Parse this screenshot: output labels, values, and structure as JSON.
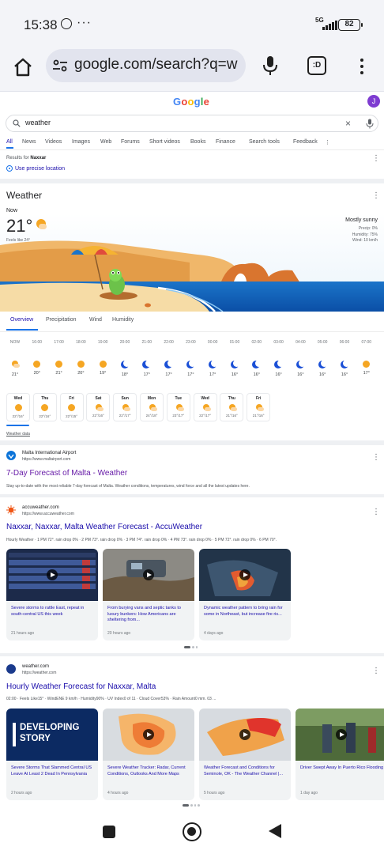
{
  "status": {
    "time": "15:38",
    "dots": "···",
    "network": "5G",
    "battery": "82"
  },
  "browser": {
    "url": "google.com/search?q=w",
    "tabs_label": ":D"
  },
  "google": {
    "logo": "Google",
    "avatar_initial": "J"
  },
  "search": {
    "query": "weather",
    "clear": "×"
  },
  "tabs": [
    "All",
    "News",
    "Videos",
    "Images",
    "Web",
    "Forums",
    "Short videos",
    "Books",
    "Finance",
    "Search tools",
    "Feedback"
  ],
  "location": {
    "prefix": "Results for",
    "place": "Naxxar",
    "precise": "Use precise location"
  },
  "weather": {
    "title": "Weather",
    "now": "Now",
    "temp": "21°",
    "feels": "Feels like 24°",
    "condition": "Mostly sunny",
    "precip": "Precip: 0%",
    "humidity": "Humidity: 75%",
    "wind": "Wind: 10 km/h",
    "tabs": [
      "Overview",
      "Precipitation",
      "Wind",
      "Humidity"
    ],
    "hourly": [
      {
        "time": "NOW",
        "icon": "partly-cloudy-icon",
        "temp": "21°"
      },
      {
        "time": "16:00",
        "icon": "sun-icon",
        "temp": "20°"
      },
      {
        "time": "17:00",
        "icon": "sun-icon",
        "temp": "21°"
      },
      {
        "time": "18:00",
        "icon": "sun-icon",
        "temp": "20°"
      },
      {
        "time": "19:00",
        "icon": "sun-icon",
        "temp": "19°"
      },
      {
        "time": "20:00",
        "icon": "moon-icon",
        "temp": "18°"
      },
      {
        "time": "21:00",
        "icon": "moon-icon",
        "temp": "17°"
      },
      {
        "time": "22:00",
        "icon": "moon-icon",
        "temp": "17°"
      },
      {
        "time": "23:00",
        "icon": "moon-icon",
        "temp": "17°"
      },
      {
        "time": "00:00",
        "icon": "moon-icon",
        "temp": "17°"
      },
      {
        "time": "01:00",
        "icon": "moon-icon",
        "temp": "16°"
      },
      {
        "time": "02:00",
        "icon": "moon-icon",
        "temp": "16°"
      },
      {
        "time": "03:00",
        "icon": "moon-icon",
        "temp": "16°"
      },
      {
        "time": "04:00",
        "icon": "moon-icon",
        "temp": "16°"
      },
      {
        "time": "05:00",
        "icon": "moon-icon",
        "temp": "16°"
      },
      {
        "time": "06:00",
        "icon": "moon-icon",
        "temp": "16°"
      },
      {
        "time": "07:00",
        "icon": "sun-icon",
        "temp": "17°"
      }
    ],
    "daily": [
      {
        "day": "Wed",
        "temps": "22°/16°",
        "icon": "sun-icon"
      },
      {
        "day": "Thu",
        "temps": "22°/16°",
        "icon": "sun-icon"
      },
      {
        "day": "Fri",
        "temps": "22°/15°",
        "icon": "sun-icon"
      },
      {
        "day": "Sat",
        "temps": "22°/16°",
        "icon": "partly-cloudy-icon"
      },
      {
        "day": "Sun",
        "temps": "22°/17°",
        "icon": "partly-cloudy-icon"
      },
      {
        "day": "Mon",
        "temps": "24°/18°",
        "icon": "partly-cloudy-icon"
      },
      {
        "day": "Tue",
        "temps": "23°/17°",
        "icon": "partly-cloudy-icon"
      },
      {
        "day": "Wed",
        "temps": "22°/17°",
        "icon": "partly-cloudy-icon"
      },
      {
        "day": "Thu",
        "temps": "21°/16°",
        "icon": "partly-cloudy-icon"
      },
      {
        "day": "Fri",
        "temps": "21°/16°",
        "icon": "partly-cloudy-icon"
      }
    ],
    "data_link": "Weather data"
  },
  "results": [
    {
      "site": "Malta International Airport",
      "url": "https://www.maltairport.com",
      "title": "7-Day Forecast of Malta - Weather",
      "snippet": "Stay up-to-date with the most reliable 7-day forecast of Malta. Weather conditions, temperatures, wind force and all the latest updates here."
    },
    {
      "site": "accuweather.com",
      "url": "https://www.accuweather.com",
      "title": "Naxxar, Naxxar, Malta Weather Forecast - AccuWeather",
      "snippet": "Hourly Weather · 1 PM 72°. rain drop 0% · 2 PM 73°. rain drop 0% · 3 PM 74°. rain drop 0% · 4 PM 73°. rain drop 0% · 5 PM 72°. rain drop 0% · 6 PM 70°.",
      "videos": [
        {
          "title": "Severe storms to rattle East, repeat in south-central US this week",
          "time": "21 hours ago"
        },
        {
          "title": "From burying vans and septic tanks to luxury bunkers: How Americans are sheltering from...",
          "time": "20 hours ago"
        },
        {
          "title": "Dynamic weather pattern to bring rain for some in Northeast, but increase fire ris...",
          "time": "4 days ago"
        }
      ]
    },
    {
      "site": "weather.com",
      "url": "https://weather.com",
      "title": "Hourly Weather Forecast for Naxxar, Malta",
      "snippet": "02:00 · Feels Like15° · WindENE 9 km/h · Humidity90% · UV Index0 of 11 · Cloud Cover53% · Rain Amount0 mm. 03 ...",
      "videos": [
        {
          "title": "Severe Storms That Slammed Central US Leave At Least 2 Dead In Pennsylvania",
          "time": "2 hours ago",
          "overlay": "DEVELOPING STORY"
        },
        {
          "title": "Severe Weather Tracker: Radar, Current Conditions, Outlooks And More Maps",
          "time": "4 hours ago"
        },
        {
          "title": "Weather Forecast and Conditions for Seminole, OK - The Weather Channel |...",
          "time": "5 hours ago"
        },
        {
          "title": "Driver Swept Away In Puerto Rico Flooding",
          "time": "1 day ago"
        }
      ]
    }
  ],
  "colors": {
    "link": "#1a0dab",
    "visited": "#681da8",
    "accent": "#1a73e8",
    "sun": "#f5a623",
    "moon": "#1a4fd6"
  }
}
